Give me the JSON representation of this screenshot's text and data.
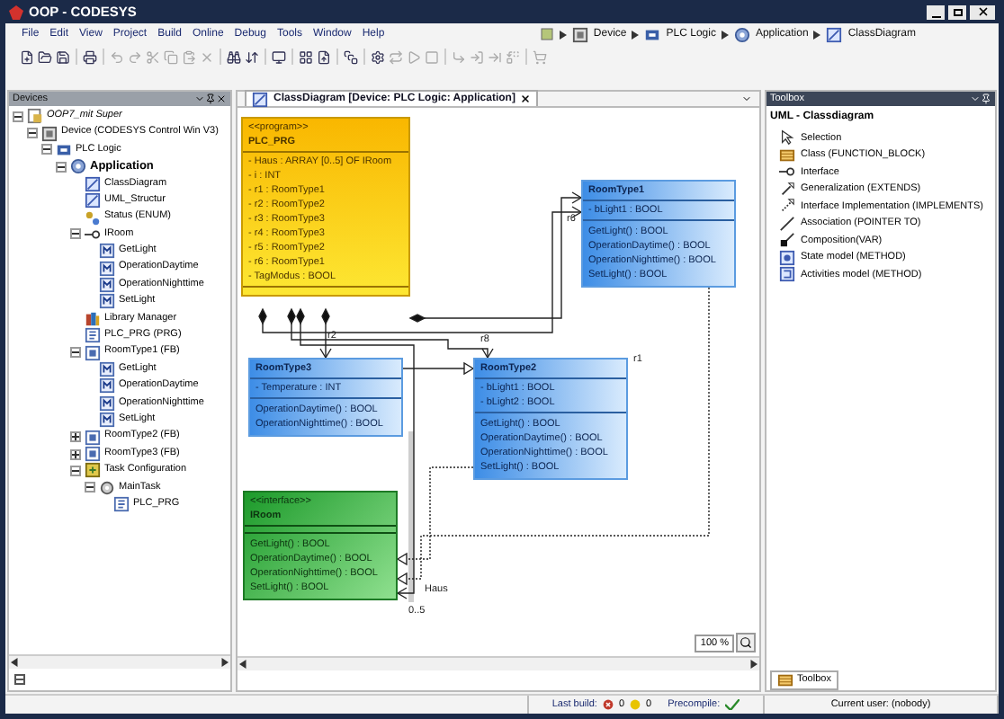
{
  "window": {
    "title": "OOP - CODESYS"
  },
  "menu": [
    "File",
    "Edit",
    "View",
    "Project",
    "Build",
    "Online",
    "Debug",
    "Tools",
    "Window",
    "Help"
  ],
  "breadcrumb": [
    {
      "label": "Device",
      "kind": "device"
    },
    {
      "label": "PLC Logic",
      "kind": "plc"
    },
    {
      "label": "Application",
      "kind": "application"
    },
    {
      "label": "ClassDiagram",
      "kind": "diagram"
    }
  ],
  "devices": {
    "title": "Devices",
    "tree": [
      {
        "label": "OOP7_mit Super",
        "kind": "project",
        "expanded": true,
        "children": [
          {
            "label": "Device (CODESYS Control Win V3)",
            "kind": "device",
            "expanded": true,
            "children": [
              {
                "label": "PLC Logic",
                "kind": "plc",
                "expanded": true,
                "children": [
                  {
                    "label": "Application",
                    "kind": "application",
                    "expanded": true,
                    "children": [
                      {
                        "label": "ClassDiagram",
                        "kind": "diagram"
                      },
                      {
                        "label": "UML_Structur",
                        "kind": "diagram"
                      },
                      {
                        "label": "Status (ENUM)",
                        "kind": "enum"
                      },
                      {
                        "label": "IRoom",
                        "kind": "interface",
                        "expanded": true,
                        "children": [
                          {
                            "label": "GetLight",
                            "kind": "method"
                          },
                          {
                            "label": "OperationDaytime",
                            "kind": "method"
                          },
                          {
                            "label": "OperationNighttime",
                            "kind": "method"
                          },
                          {
                            "label": "SetLight",
                            "kind": "method"
                          }
                        ]
                      },
                      {
                        "label": "Library Manager",
                        "kind": "library"
                      },
                      {
                        "label": "PLC_PRG (PRG)",
                        "kind": "program"
                      },
                      {
                        "label": "RoomType1 (FB)",
                        "kind": "fb",
                        "expanded": true,
                        "children": [
                          {
                            "label": "GetLight",
                            "kind": "method"
                          },
                          {
                            "label": "OperationDaytime",
                            "kind": "method"
                          },
                          {
                            "label": "OperationNighttime",
                            "kind": "method"
                          },
                          {
                            "label": "SetLight",
                            "kind": "method"
                          }
                        ]
                      },
                      {
                        "label": "RoomType2 (FB)",
                        "kind": "fb",
                        "expanded": false
                      },
                      {
                        "label": "RoomType3 (FB)",
                        "kind": "fb",
                        "expanded": false
                      },
                      {
                        "label": "Task Configuration",
                        "kind": "taskconfig",
                        "expanded": true,
                        "children": [
                          {
                            "label": "MainTask",
                            "kind": "task",
                            "expanded": true,
                            "children": [
                              {
                                "label": "PLC_PRG",
                                "kind": "program"
                              }
                            ]
                          }
                        ]
                      }
                    ]
                  }
                ]
              }
            ]
          }
        ]
      }
    ]
  },
  "editor": {
    "tab": {
      "label": "ClassDiagram [Device: PLC Logic: Application]",
      "selected": true
    },
    "classes": [
      {
        "kind": "program",
        "stereotype": "<<program>>",
        "name": "PLC_PRG",
        "attributes": [
          "- Haus : ARRAY [0..5] OF IRoom",
          "- i : INT",
          "- r1 : RoomType1",
          "- r2 : RoomType2",
          "- r3 : RoomType3",
          "- r4 : RoomType3",
          "- r5 : RoomType2",
          "- r6 : RoomType1",
          "- TagModus : BOOL"
        ]
      },
      {
        "kind": "fb",
        "name": "RoomType1",
        "attributes": [
          "- bLight1 : BOOL"
        ],
        "methods": [
          "GetLight() : BOOL",
          "OperationDaytime() : BOOL",
          "OperationNighttime() : BOOL",
          "SetLight() : BOOL"
        ]
      },
      {
        "kind": "fb",
        "name": "RoomType3",
        "attributes": [
          "- Temperature : INT"
        ],
        "methods": [
          "OperationDaytime() : BOOL",
          "OperationNighttime() : BOOL"
        ]
      },
      {
        "kind": "fb",
        "name": "RoomType2",
        "attributes": [
          "- bLight1 : BOOL",
          "- bLight2 : BOOL"
        ],
        "methods": [
          "GetLight() : BOOL",
          "OperationDaytime() : BOOL",
          "OperationNighttime() : BOOL",
          "SetLight() : BOOL"
        ]
      },
      {
        "kind": "interface",
        "stereotype": "<<interface>>",
        "name": "IRoom",
        "methods": [
          "GetLight() : BOOL",
          "OperationDaytime() : BOOL",
          "OperationNighttime() : BOOL",
          "SetLight() : BOOL"
        ]
      }
    ],
    "labels": [
      "r6",
      "r2",
      "r8",
      "r1",
      "Haus",
      "0..5"
    ],
    "zoom": "100 %"
  },
  "toolbox": {
    "title": "Toolbox",
    "heading": "UML - Classdiagram",
    "items": [
      {
        "label": "Selection",
        "kind": "pointer"
      },
      {
        "label": "Class (FUNCTION_BLOCK)",
        "kind": "class"
      },
      {
        "label": "Interface",
        "kind": "interface"
      },
      {
        "label": "Generalization (EXTENDS)",
        "kind": "generalization"
      },
      {
        "label": "Interface Implementation (IMPLEMENTS)",
        "kind": "implementation"
      },
      {
        "label": "Association (POINTER TO)",
        "kind": "association"
      },
      {
        "label": "Composition(VAR)",
        "kind": "composition"
      },
      {
        "label": "State model (METHOD)",
        "kind": "state"
      },
      {
        "label": "Activities model (METHOD)",
        "kind": "activity"
      }
    ],
    "bottom_tab": "Toolbox"
  },
  "status_bar": {
    "last_build": "Last build:",
    "errors": "0",
    "warnings": "0",
    "precompile": "Precompile:",
    "precompile_ok": true,
    "user": "Current user: (nobody)"
  }
}
